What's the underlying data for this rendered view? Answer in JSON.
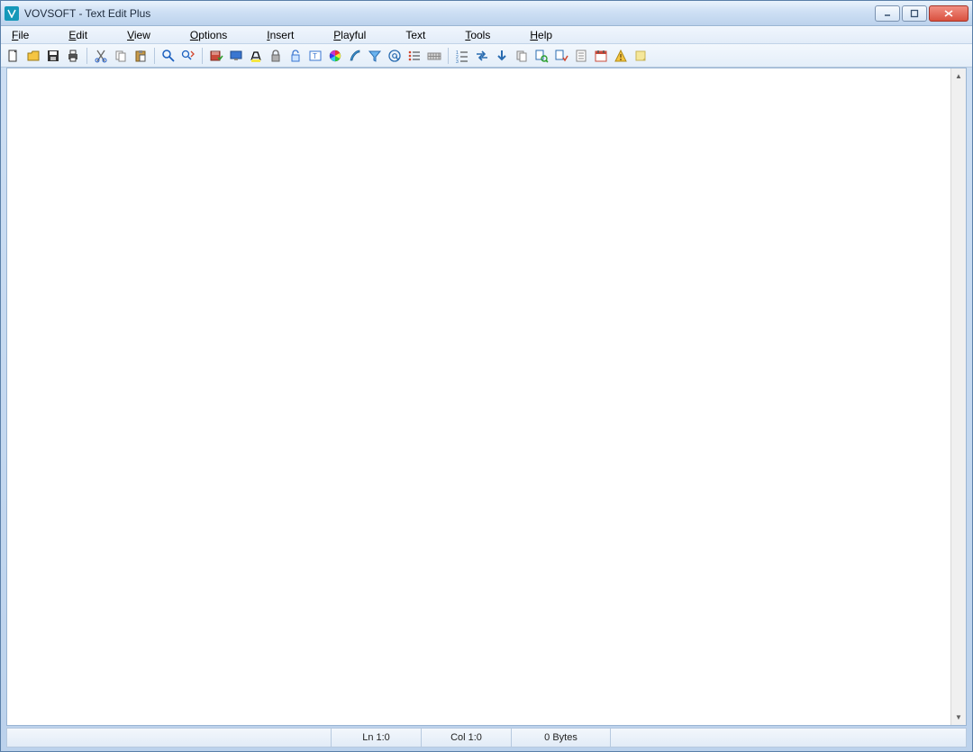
{
  "window": {
    "title": "VOVSOFT - Text Edit Plus"
  },
  "menu": {
    "file": "File",
    "edit": "Edit",
    "view": "View",
    "options": "Options",
    "insert": "Insert",
    "playful": "Playful",
    "text": "Text",
    "tools": "Tools",
    "help": "Help"
  },
  "toolbar_icons": {
    "new": "new-file",
    "open": "open-file",
    "save": "save-file",
    "print": "print",
    "cut": "cut",
    "copy": "copy",
    "paste": "paste",
    "find": "find",
    "replace": "replace",
    "spellcheck": "spellcheck",
    "screen": "fullscreen",
    "highlight": "highlight",
    "lock": "lock",
    "lock2": "lock-alt",
    "insert_text": "insert-text",
    "color": "color-picker",
    "brush": "brush",
    "filter": "filter",
    "at": "at-sign",
    "list": "list",
    "table": "table",
    "numbered": "numbered-list",
    "left_right": "swap-horizontal",
    "down": "arrow-down",
    "copy2": "duplicate",
    "find_in": "find-in-files",
    "replace_in": "replace-in-files",
    "doc": "document",
    "calendar": "calendar",
    "warn": "warning",
    "note": "note"
  },
  "editor": {
    "content": ""
  },
  "status": {
    "line": "Ln 1:0",
    "col": "Col 1:0",
    "bytes": "0 Bytes"
  }
}
